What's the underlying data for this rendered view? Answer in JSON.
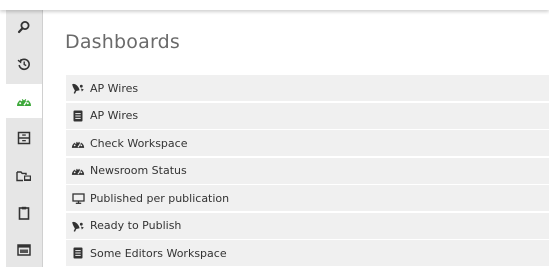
{
  "page": {
    "title": "Dashboards"
  },
  "sidebar": {
    "items": [
      {
        "name": "search",
        "icon": "search-icon"
      },
      {
        "name": "history",
        "icon": "history-icon"
      },
      {
        "name": "dashboards",
        "icon": "dashboard-gauge-icon",
        "active": true
      },
      {
        "name": "archive",
        "icon": "archive-box-icon"
      },
      {
        "name": "workspaces",
        "icon": "folder-device-icon"
      },
      {
        "name": "clipboard",
        "icon": "clipboard-icon"
      },
      {
        "name": "browser",
        "icon": "browser-window-icon"
      }
    ]
  },
  "dashboards": [
    {
      "label": "AP Wires",
      "icon": "satellite-dish-icon"
    },
    {
      "label": "AP Wires",
      "icon": "document-icon"
    },
    {
      "label": "Check Workspace",
      "icon": "dashboard-gauge-icon"
    },
    {
      "label": "Newsroom Status",
      "icon": "dashboard-gauge-icon"
    },
    {
      "label": "Published per publication",
      "icon": "monitor-icon"
    },
    {
      "label": "Ready to Publish",
      "icon": "satellite-dish-icon"
    },
    {
      "label": "Some Editors Workspace",
      "icon": "document-icon"
    }
  ],
  "colors": {
    "accent": "#3da83a",
    "sidebar_bg": "#e6e6e6",
    "row_bg": "#f0f0f0",
    "text": "#333333",
    "title": "#6a6a6a"
  }
}
